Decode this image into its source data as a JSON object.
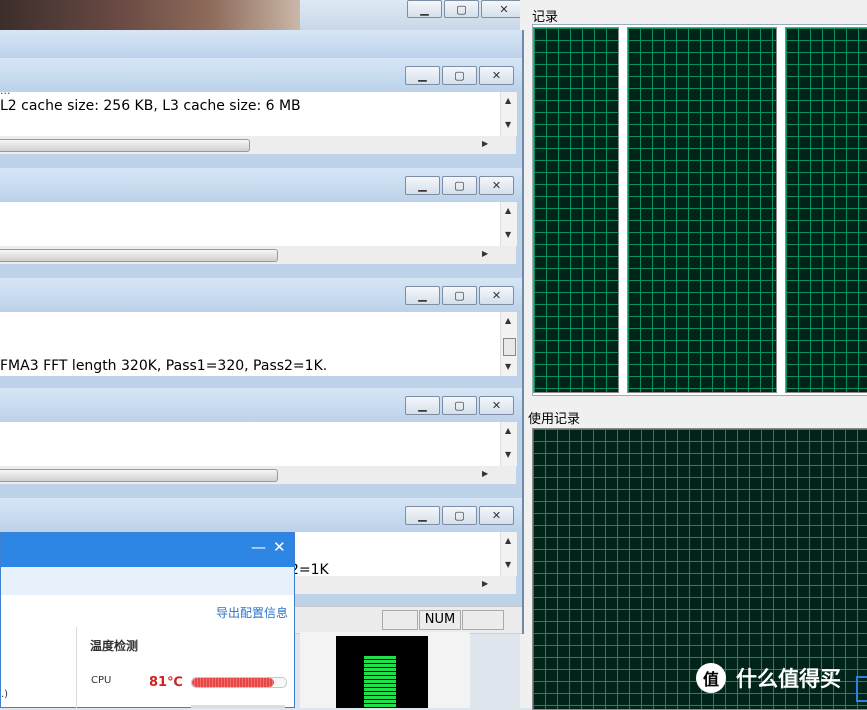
{
  "top_window": {
    "min": "▁",
    "max": "▢",
    "close": "✕"
  },
  "task_manager": {
    "cpu_history_label": "记录",
    "mem_history_label": "使用记录",
    "status_num": "NUM"
  },
  "consoles": [
    {
      "text": "L2 cache size: 256 KB, L3 cache size: 6 MB",
      "top_fragment": "...",
      "thumb": 0.48
    },
    {
      "text": "",
      "thumb": 0.53
    },
    {
      "text": "FMA3 FFT length 320K, Pass1=320, Pass2=1K.",
      "thumb": 0
    },
    {
      "text": "",
      "thumb": 0.53
    },
    {
      "text": "2=1K",
      "thumb": 0
    }
  ],
  "buttons": {
    "min": "▁",
    "max": "▢",
    "close": "✕"
  },
  "pc_manager": {
    "minimize": "—",
    "close": "✕",
    "export_link": "导出配置信息",
    "temp_title": "温度检测",
    "cpu_label": "CPU",
    "cpu_temp": "81℃",
    "left_fragment": ".)"
  },
  "watermark": {
    "text": "什么值得买",
    "logo": "值"
  }
}
